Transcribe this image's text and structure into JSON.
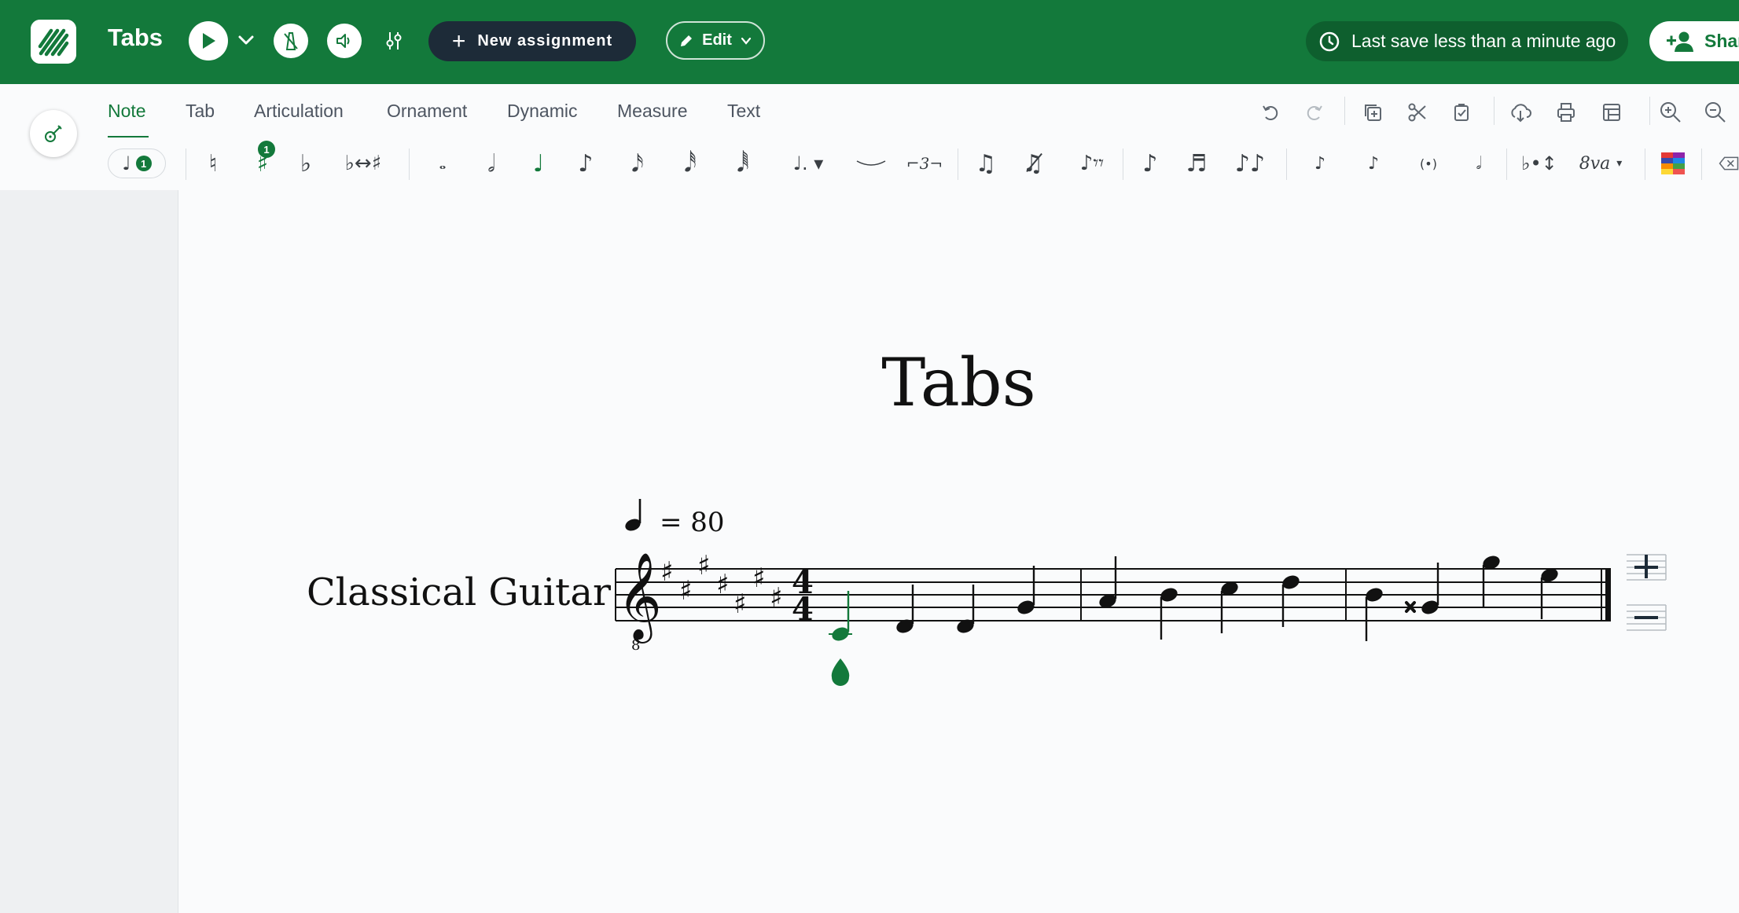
{
  "app": {
    "title": "Tabs",
    "new_assignment_label": "New assignment",
    "edit_label": "Edit",
    "save_status": "Last save less than a minute ago",
    "share_label": "Shar"
  },
  "tabs": [
    {
      "label": "Note",
      "active": true
    },
    {
      "label": "Tab"
    },
    {
      "label": "Articulation"
    },
    {
      "label": "Ornament"
    },
    {
      "label": "Dynamic"
    },
    {
      "label": "Measure"
    },
    {
      "label": "Text"
    }
  ],
  "palette": {
    "voice_badge": "1",
    "sharp_badge": "1",
    "tuplet_label": "3",
    "ottava_label": "8va"
  },
  "score": {
    "title": "Tabs",
    "instrument": "Classical Guitar",
    "tempo_value": "= 80",
    "time_signature_top": "4",
    "time_signature_bottom": "4",
    "clef_octave": "8"
  },
  "colors": {
    "brand_green": "#13793b",
    "dark_pill": "#1d2b38",
    "selection_green": "#13793b"
  }
}
